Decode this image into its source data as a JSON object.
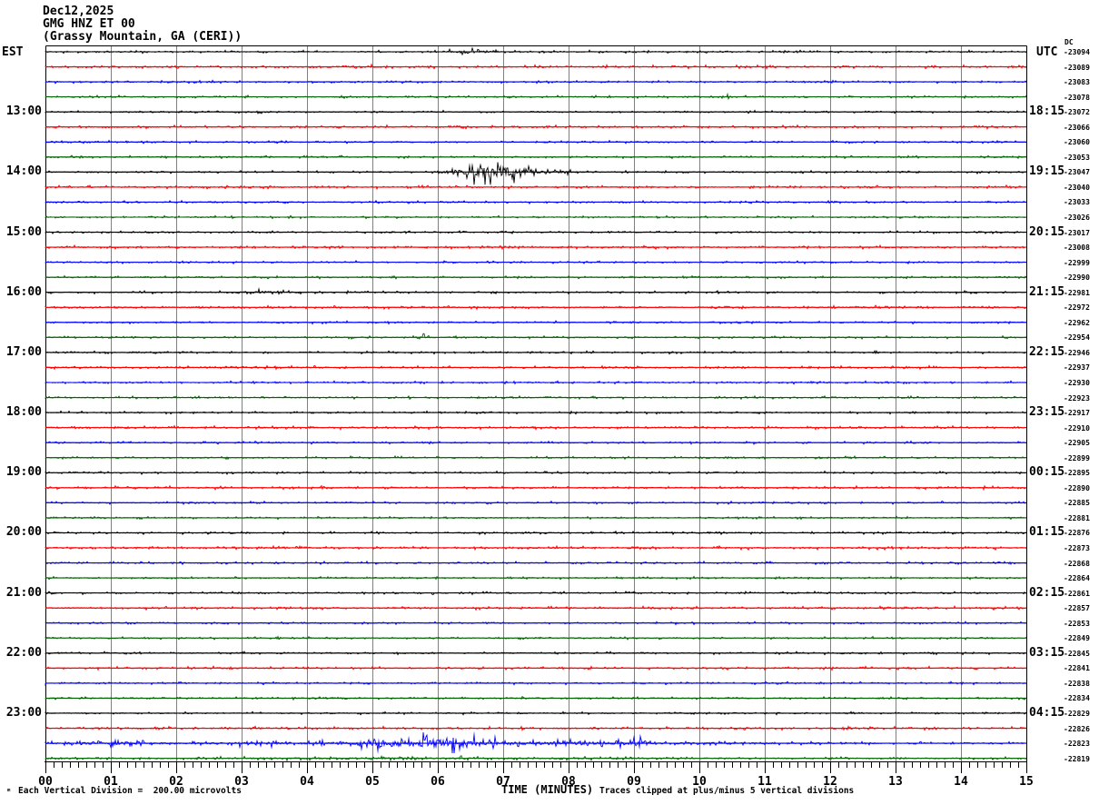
{
  "title": {
    "date": "Dec12,2025",
    "station": "GMG HNZ ET 00",
    "location": "(Grassy Mountain, GA (CERI))"
  },
  "axes": {
    "left_header": "EST",
    "right_header": "UTC",
    "dc_label": "DC",
    "corner_mark": "ₘ",
    "xlabel": "TIME (MINUTES)",
    "x_ticks": [
      "00",
      "01",
      "02",
      "03",
      "04",
      "05",
      "06",
      "07",
      "08",
      "09",
      "10",
      "11",
      "12",
      "13",
      "14",
      "15"
    ],
    "footnote_left": "Each Vertical Division =  200.00 microvolts",
    "footnote_right": "Traces clipped at plus/minus 5 vertical divisions"
  },
  "chart_data": {
    "type": "line",
    "subtype": "helicorder-seismogram",
    "title": "GMG HNZ ET 00 (Grassy Mountain, GA (CERI)) Dec12,2025",
    "xlabel": "TIME (MINUTES)",
    "x_range_minutes": [
      0,
      15
    ],
    "minutes_per_line": 15,
    "lines_per_hour": 4,
    "grid": true,
    "vertical_division_microvolts": 200.0,
    "clip_divisions": 5,
    "color_cycle": [
      "#000000",
      "#ff0000",
      "#0000ff",
      "#006400"
    ],
    "grid_color": "#808080",
    "traces": [
      {
        "counts": "-23094",
        "note": "DC",
        "env": [
          [
            6.0,
            0.8
          ],
          [
            6.25,
            2.0
          ],
          [
            6.45,
            3.2
          ],
          [
            6.6,
            2.4
          ],
          [
            6.8,
            1.3
          ],
          [
            7.05,
            0.8
          ]
        ]
      },
      {
        "counts": "-23089",
        "env": [
          [
            3.8,
            1.0
          ],
          [
            4.3,
            1.9
          ],
          [
            4.9,
            1.7
          ],
          [
            5.5,
            1.0
          ]
        ]
      },
      {
        "counts": "-23083"
      },
      {
        "counts": "-23078",
        "env": [
          [
            10.35,
            0.7
          ],
          [
            10.45,
            2.2
          ],
          [
            10.55,
            0.7
          ]
        ]
      },
      {
        "counts": "-23072",
        "est": "13:00",
        "utc": "18:15"
      },
      {
        "counts": "-23066"
      },
      {
        "counts": "-23060"
      },
      {
        "counts": "-23053"
      },
      {
        "counts": "-23047",
        "est": "14:00",
        "utc": "19:15",
        "env": [
          [
            5.2,
            1.0
          ],
          [
            5.9,
            1.1
          ],
          [
            6.15,
            2.5
          ],
          [
            6.4,
            5.0
          ],
          [
            6.55,
            9.0
          ],
          [
            6.7,
            13.0
          ],
          [
            6.85,
            9.0
          ],
          [
            7.0,
            12.0
          ],
          [
            7.15,
            8.0
          ],
          [
            7.3,
            9.0
          ],
          [
            7.45,
            5.0
          ],
          [
            7.65,
            3.5
          ],
          [
            7.9,
            2.2
          ],
          [
            8.2,
            1.3
          ],
          [
            8.6,
            0.8
          ]
        ]
      },
      {
        "counts": "-23040"
      },
      {
        "counts": "-23033"
      },
      {
        "counts": "-23026"
      },
      {
        "counts": "-23017",
        "est": "15:00",
        "utc": "20:15"
      },
      {
        "counts": "-23008"
      },
      {
        "counts": "-22999"
      },
      {
        "counts": "-22990"
      },
      {
        "counts": "-22981",
        "est": "16:00",
        "utc": "21:15",
        "env": [
          [
            2.8,
            1.0
          ],
          [
            3.1,
            2.0
          ],
          [
            3.6,
            1.9
          ],
          [
            4.1,
            1.3
          ],
          [
            4.5,
            0.9
          ]
        ]
      },
      {
        "counts": "-22972"
      },
      {
        "counts": "-22962"
      },
      {
        "counts": "-22954",
        "env": [
          [
            5.68,
            0.7
          ],
          [
            5.78,
            4.0
          ],
          [
            5.9,
            0.7
          ]
        ]
      },
      {
        "counts": "-22946",
        "est": "17:00",
        "utc": "22:15"
      },
      {
        "counts": "-22937"
      },
      {
        "counts": "-22930"
      },
      {
        "counts": "-22923"
      },
      {
        "counts": "-22917",
        "est": "18:00",
        "utc": "23:15"
      },
      {
        "counts": "-22910"
      },
      {
        "counts": "-22905"
      },
      {
        "counts": "-22899"
      },
      {
        "counts": "-22895",
        "est": "19:00",
        "utc": "00:15"
      },
      {
        "counts": "-22890"
      },
      {
        "counts": "-22885"
      },
      {
        "counts": "-22881"
      },
      {
        "counts": "-22876",
        "est": "20:00",
        "utc": "01:15"
      },
      {
        "counts": "-22873"
      },
      {
        "counts": "-22868"
      },
      {
        "counts": "-22864"
      },
      {
        "counts": "-22861",
        "est": "21:00",
        "utc": "02:15"
      },
      {
        "counts": "-22857"
      },
      {
        "counts": "-22853"
      },
      {
        "counts": "-22849"
      },
      {
        "counts": "-22845",
        "est": "22:00",
        "utc": "03:15"
      },
      {
        "counts": "-22841"
      },
      {
        "counts": "-22838"
      },
      {
        "counts": "-22834"
      },
      {
        "counts": "-22829",
        "est": "23:00",
        "utc": "04:15"
      },
      {
        "counts": "-22826"
      },
      {
        "counts": "-22823",
        "env": [
          [
            0.0,
            1.0
          ],
          [
            0.35,
            1.8
          ],
          [
            0.9,
            2.8
          ],
          [
            1.3,
            3.2
          ],
          [
            1.7,
            1.8
          ],
          [
            2.4,
            1.6
          ],
          [
            3.3,
            2.6
          ],
          [
            3.9,
            2.0
          ],
          [
            4.4,
            2.6
          ],
          [
            4.9,
            3.6
          ],
          [
            5.15,
            6.5
          ],
          [
            5.35,
            8.5
          ],
          [
            5.55,
            5.5
          ],
          [
            5.75,
            7.5
          ],
          [
            5.95,
            9.0
          ],
          [
            6.15,
            5.5
          ],
          [
            6.35,
            6.5
          ],
          [
            6.6,
            4.5
          ],
          [
            6.9,
            3.8
          ],
          [
            7.4,
            3.2
          ],
          [
            7.9,
            2.6
          ],
          [
            8.3,
            3.6
          ],
          [
            8.6,
            2.2
          ],
          [
            8.95,
            3.2
          ],
          [
            9.1,
            4.2
          ],
          [
            9.25,
            2.0
          ],
          [
            9.6,
            1.6
          ],
          [
            10.2,
            1.9
          ],
          [
            10.8,
            1.6
          ],
          [
            11.5,
            1.3
          ],
          [
            12.2,
            1.1
          ],
          [
            12.7,
            0.9
          ],
          [
            15.0,
            0.9
          ]
        ]
      },
      {
        "counts": "-22819",
        "env": [
          [
            2.0,
            1.0
          ],
          [
            3.0,
            1.4
          ],
          [
            6.0,
            1.5
          ],
          [
            9.0,
            1.2
          ],
          [
            10.0,
            1.0
          ]
        ]
      }
    ]
  }
}
